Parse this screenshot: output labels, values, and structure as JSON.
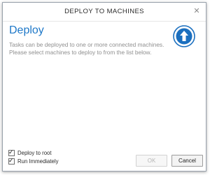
{
  "window": {
    "title": "DEPLOY TO MACHINES",
    "close_glyph": "✕"
  },
  "content": {
    "heading": "Deploy",
    "description": "Tasks can be deployed to one or more connected machines. Please select machines to deploy to from the list below.",
    "icon": "upload-arrow-icon"
  },
  "options": {
    "deploy_to_root": {
      "label": "Deploy to root",
      "checked": true
    },
    "run_immediately": {
      "label": "Run Immediately",
      "checked": true
    }
  },
  "buttons": {
    "ok_label": "OK",
    "ok_enabled": false,
    "cancel_label": "Cancel"
  },
  "colors": {
    "accent": "#1e78c8",
    "icon_circle": "#1b6fbf"
  }
}
